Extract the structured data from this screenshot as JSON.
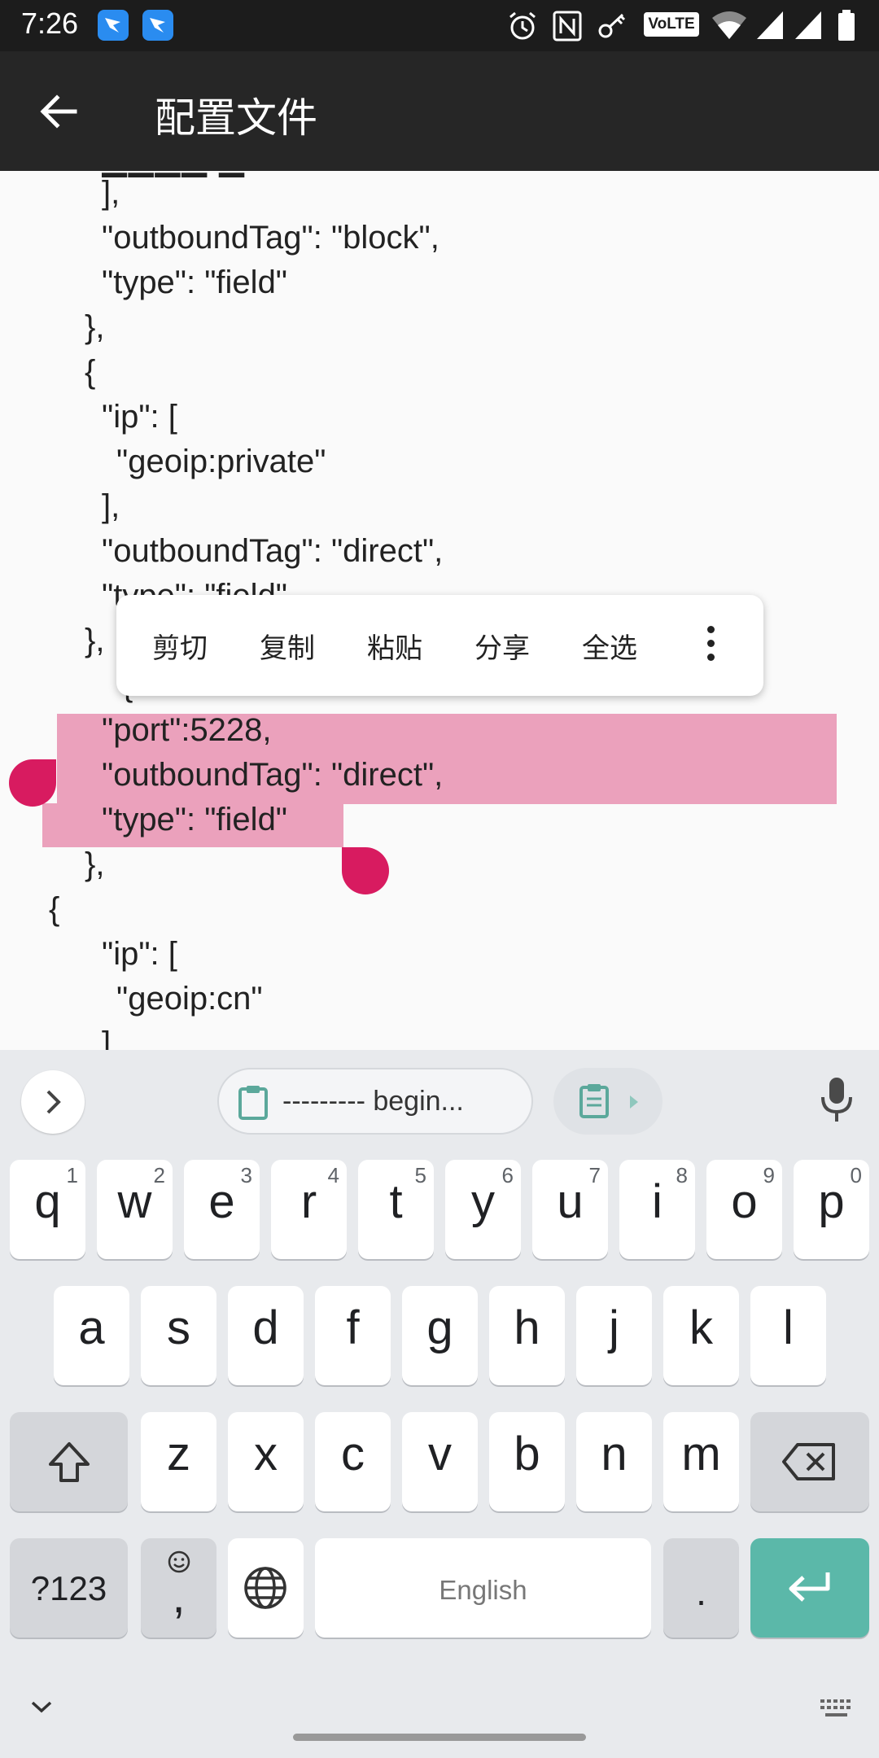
{
  "status_bar": {
    "time": "7:26",
    "volte": "VoLTE",
    "icons": [
      "app-badge-icon",
      "app-badge-icon",
      "alarm-icon",
      "nfc-icon",
      "key-icon",
      "volte-icon",
      "wifi-icon",
      "signal-icon",
      "signal-icon",
      "battery-icon"
    ]
  },
  "app_bar": {
    "title": "配置文件",
    "back_icon": "back-arrow-icon"
  },
  "editor": {
    "lines": [
      "],",
      "\"outboundTag\": \"block\",",
      "\"type\": \"field\"",
      "},",
      "{",
      "\"ip\": [",
      "\"geoip:private\"",
      "],",
      "\"outboundTag\": \"direct\",",
      "\"type\": \"field\"",
      "},",
      "{",
      "\"port\":5228,",
      "\"outboundTag\": \"direct\",",
      "\"type\": \"field\"",
      "},",
      "{",
      "\"ip\": [",
      "\"geoip:cn\"",
      "]"
    ]
  },
  "context_menu": {
    "items": [
      "剪切",
      "复制",
      "粘贴",
      "分享",
      "全选"
    ],
    "more_icon": "more-vert-icon"
  },
  "keyboard": {
    "clipboard_text": "--------- begin...",
    "row1": [
      {
        "key": "q",
        "hint": "1"
      },
      {
        "key": "w",
        "hint": "2"
      },
      {
        "key": "e",
        "hint": "3"
      },
      {
        "key": "r",
        "hint": "4"
      },
      {
        "key": "t",
        "hint": "5"
      },
      {
        "key": "y",
        "hint": "6"
      },
      {
        "key": "u",
        "hint": "7"
      },
      {
        "key": "i",
        "hint": "8"
      },
      {
        "key": "o",
        "hint": "9"
      },
      {
        "key": "p",
        "hint": "0"
      }
    ],
    "row2": [
      "a",
      "s",
      "d",
      "f",
      "g",
      "h",
      "j",
      "k",
      "l"
    ],
    "row3": [
      "z",
      "x",
      "c",
      "v",
      "b",
      "n",
      "m"
    ],
    "symbols_key": "?123",
    "comma_key": ",",
    "space_label": "English",
    "period_key": ".",
    "colors": {
      "enter": "#5bb8a9",
      "selection": "#eba1bc",
      "handle": "#d81b60"
    }
  }
}
